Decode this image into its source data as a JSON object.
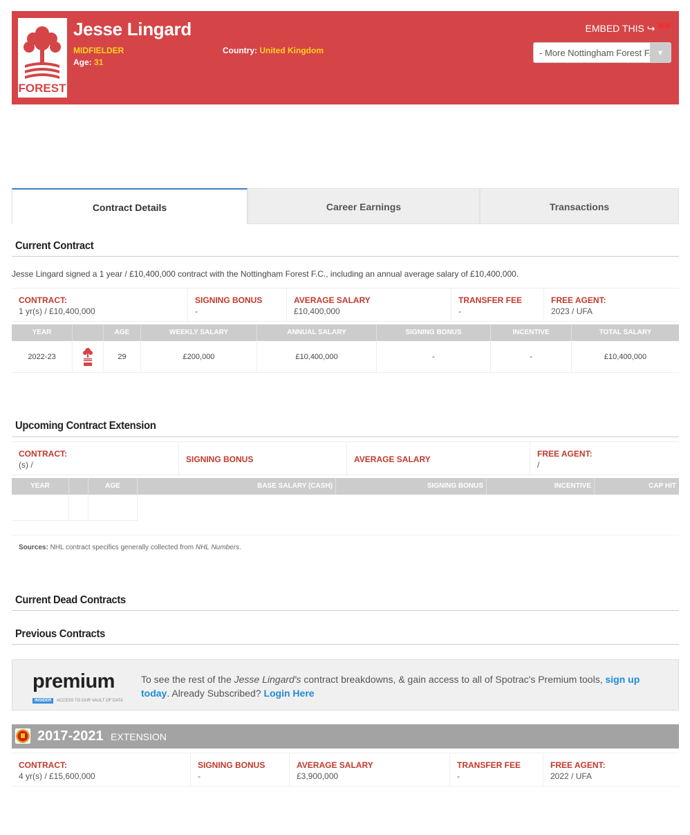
{
  "player": {
    "name": "Jesse Lingard",
    "position": "MIDFIELDER",
    "age_label": "Age:",
    "age_value": "31",
    "country_label": "Country:",
    "country_value": "United Kingdom"
  },
  "header": {
    "embed_label": "EMBED THIS",
    "new_badge": "NEW",
    "team_select_value": "- More Nottingham Forest F.C. Players -",
    "logo_text": "FOREST"
  },
  "tabs": [
    {
      "label": "Contract Details",
      "active": true
    },
    {
      "label": "Career Earnings",
      "active": false
    },
    {
      "label": "Transactions",
      "active": false
    }
  ],
  "current_contract": {
    "title": "Current Contract",
    "description": "Jesse Lingard signed a 1 year / £10,400,000 contract with the Nottingham Forest F.C., including an annual average salary of £10,400,000.",
    "summary": [
      {
        "label": "CONTRACT:",
        "value": "1 yr(s) / £10,400,000"
      },
      {
        "label": "SIGNING BONUS",
        "value": "-"
      },
      {
        "label": "AVERAGE SALARY",
        "value": "£10,400,000"
      },
      {
        "label": "TRANSFER FEE",
        "value": "-"
      },
      {
        "label": "FREE AGENT:",
        "value": "2023 / UFA"
      }
    ],
    "columns": [
      "YEAR",
      "",
      "AGE",
      "WEEKLY SALARY",
      "ANNUAL SALARY",
      "SIGNING BONUS",
      "INCENTIVE",
      "TOTAL SALARY"
    ],
    "rows": [
      [
        "2022-23",
        "",
        "29",
        "£200,000",
        "£10,400,000",
        "-",
        "-",
        "£10,400,000"
      ]
    ]
  },
  "extension": {
    "title": "Upcoming Contract Extension",
    "summary": [
      {
        "label": "CONTRACT:",
        "value": "(s) /"
      },
      {
        "label": "SIGNING BONUS",
        "value": ""
      },
      {
        "label": "AVERAGE SALARY",
        "value": ""
      },
      {
        "label": "FREE AGENT:",
        "value": "/"
      }
    ],
    "columns": [
      "YEAR",
      "",
      "AGE",
      "BASE SALARY (CASH)",
      "SIGNING BONUS",
      "INCENTIVE",
      "CAP HIT"
    ]
  },
  "sources": {
    "label": "Sources:",
    "text": "NHL contract specifics generally collected from",
    "link": "NHL Numbers",
    "end": "."
  },
  "dead_contracts_title": "Current Dead Contracts",
  "previous_contracts_title": "Previous Contracts",
  "premium": {
    "logo_word": "premium",
    "logo_tag": "INSIDER",
    "logo_sub": "ACCESS TO OUR VAULT OF DATA",
    "text_1": "To see the rest of the",
    "player_possessive": "Jesse Lingard's",
    "text_2": "contract breakdowns, & gain access to all of Spotrac's Premium tools,",
    "signup_link": "sign up today",
    "text_3": ". Already Subscribed?",
    "login_link": "Login Here"
  },
  "previous_extension": {
    "years": "2017-2021",
    "type": "EXTENSION",
    "summary": [
      {
        "label": "CONTRACT:",
        "value": "4 yr(s) / £15,600,000"
      },
      {
        "label": "SIGNING BONUS",
        "value": "-"
      },
      {
        "label": "AVERAGE SALARY",
        "value": "£3,900,000"
      },
      {
        "label": "TRANSFER FEE",
        "value": "-"
      },
      {
        "label": "FREE AGENT:",
        "value": "2022 / UFA"
      }
    ]
  },
  "colors": {
    "header_bg": "#d54447",
    "highlight": "#ffd21f",
    "label_red": "#c0392b",
    "link_blue": "#1f8bd8",
    "tab_accent": "#3b7fc4"
  }
}
